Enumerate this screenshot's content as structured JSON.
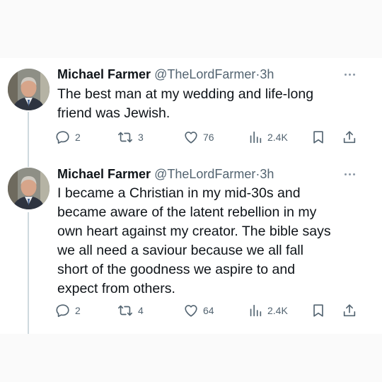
{
  "tweets": [
    {
      "name": "Michael Farmer",
      "handle": "@TheLordFarmer",
      "dot": "·",
      "time": "3h",
      "text": [
        "The best man at my wedding and life-long",
        "friend was Jewish."
      ],
      "stats": {
        "replies": "2",
        "retweets": "3",
        "likes": "76",
        "views": "2.4K"
      }
    },
    {
      "name": "Michael Farmer",
      "handle": "@TheLordFarmer",
      "dot": "·",
      "time": "3h",
      "text": [
        "I became a Christian in my mid-30s and",
        "became aware of the latent rebellion in my",
        "own heart against my creator. The bible says",
        "we all need a saviour because we all fall",
        "short of the goodness we aspire to and",
        "expect from others."
      ],
      "stats": {
        "replies": "2",
        "retweets": "4",
        "likes": "64",
        "views": "2.4K"
      }
    }
  ],
  "icons": {
    "reply": "reply-icon",
    "retweet": "retweet-icon",
    "like": "heart-icon",
    "views": "views-bar-chart-icon",
    "bookmark": "bookmark-icon",
    "share": "share-icon",
    "more": "more-dots-icon"
  },
  "colors": {
    "text": "#0f1419",
    "secondary": "#536471",
    "thread": "#cfd9de"
  }
}
